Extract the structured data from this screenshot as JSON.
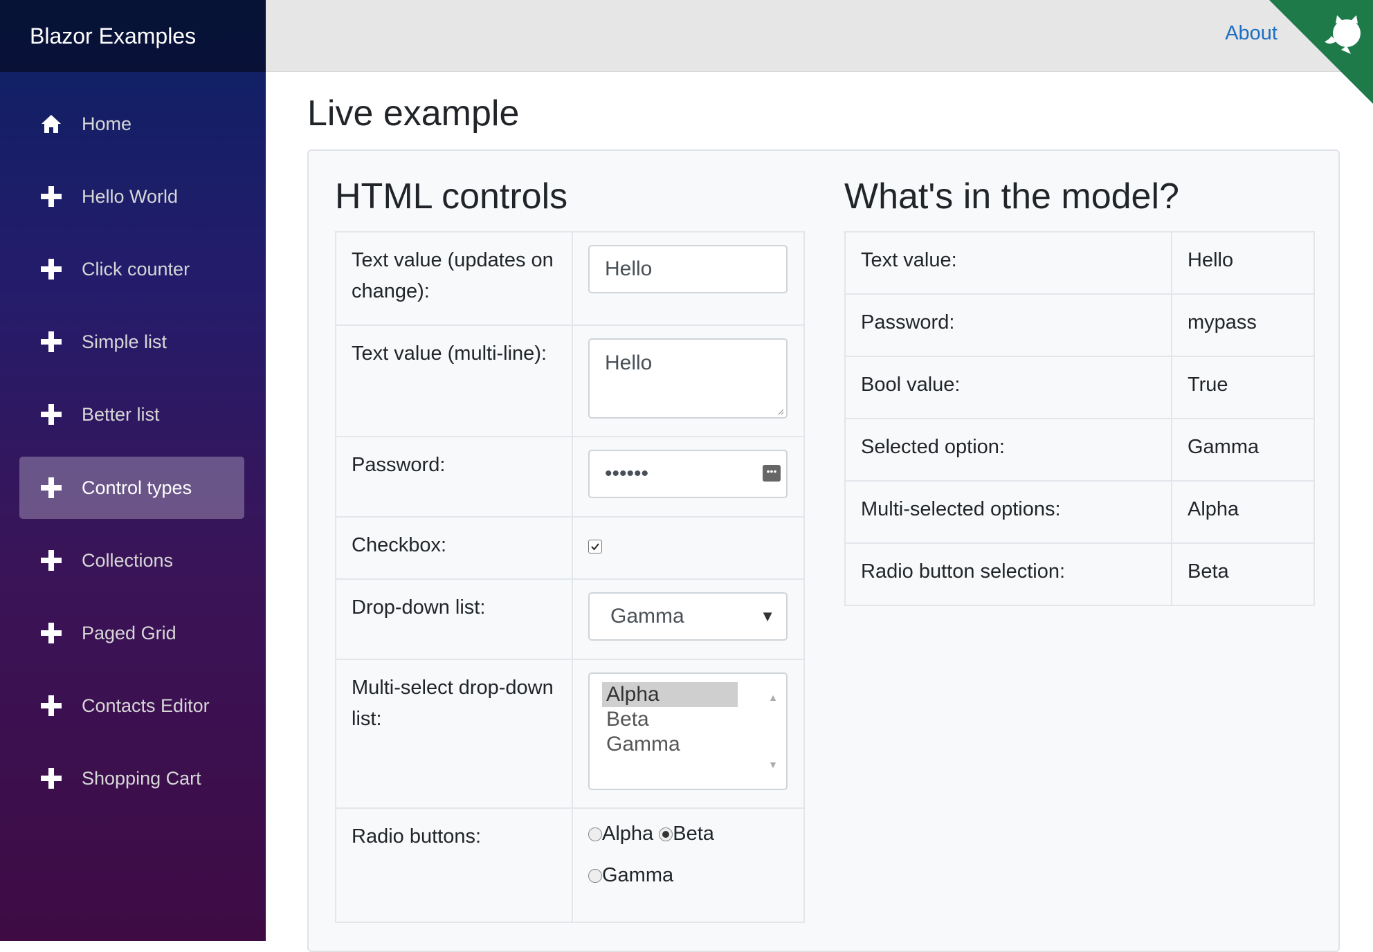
{
  "brand": "Blazor Examples",
  "nav": [
    {
      "label": "Home",
      "icon": "home-icon"
    },
    {
      "label": "Hello World",
      "icon": "plus-icon"
    },
    {
      "label": "Click counter",
      "icon": "plus-icon"
    },
    {
      "label": "Simple list",
      "icon": "plus-icon"
    },
    {
      "label": "Better list",
      "icon": "plus-icon"
    },
    {
      "label": "Control types",
      "icon": "plus-icon",
      "active": true
    },
    {
      "label": "Collections",
      "icon": "plus-icon"
    },
    {
      "label": "Paged Grid",
      "icon": "plus-icon"
    },
    {
      "label": "Contacts Editor",
      "icon": "plus-icon"
    },
    {
      "label": "Shopping Cart",
      "icon": "plus-icon"
    }
  ],
  "topbar": {
    "about": "About",
    "corner_icon": "github-icon",
    "corner_color": "#1f7a4a"
  },
  "page_title": "Live example",
  "controls": {
    "title": "HTML controls",
    "text_label": "Text value (updates on change):",
    "text_value": "Hello",
    "multiline_label": "Text value (multi-line):",
    "multiline_value": "Hello",
    "password_label": "Password:",
    "password_value": "••••••",
    "checkbox_label": "Checkbox:",
    "checkbox_checked": true,
    "dropdown_label": "Drop-down list:",
    "dropdown_value": "Gamma",
    "multiselect_label": "Multi-select drop-down list:",
    "multiselect_options": [
      "Alpha",
      "Beta",
      "Gamma"
    ],
    "multiselect_selected": "Alpha",
    "radio_label": "Radio buttons:",
    "radio_options": [
      "Alpha",
      "Beta",
      "Gamma"
    ],
    "radio_selected": "Beta"
  },
  "model": {
    "title": "What's in the model?",
    "rows": [
      {
        "label": "Text value:",
        "value": "Hello"
      },
      {
        "label": "Password:",
        "value": "mypass"
      },
      {
        "label": "Bool value:",
        "value": "True"
      },
      {
        "label": "Selected option:",
        "value": "Gamma"
      },
      {
        "label": "Multi-selected options:",
        "value": "Alpha"
      },
      {
        "label": "Radio button selection:",
        "value": "Beta"
      }
    ]
  },
  "colors": {
    "link": "#1b6ec2",
    "active_nav": "rgba(255,255,255,0.27)"
  }
}
